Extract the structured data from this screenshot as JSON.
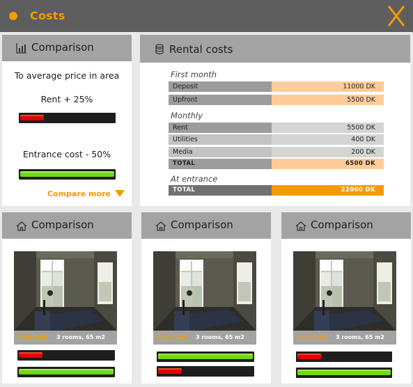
{
  "header": {
    "title": "Costs",
    "close_icon": "close-x-icon"
  },
  "colors": {
    "accent": "#f59b00",
    "header_bg": "#5e5e5e",
    "panel_head": "#a3a3a3",
    "bar_red": "#e30000",
    "bar_green": "#72d816"
  },
  "comparison": {
    "title": "Comparison",
    "subtitle": "To average price in area",
    "rent_label": "Rent + 25%",
    "rent_level": 0.25,
    "entrance_label": "Entrance cost - 50%",
    "entrance_level": 1.0,
    "compare_more": "Compare more"
  },
  "rental": {
    "title": "Rental costs",
    "first_month": {
      "heading": "First month",
      "rows": [
        {
          "label": "Deposit",
          "value": "11000 DK"
        },
        {
          "label": "Upfront",
          "value": "5500 DK"
        }
      ]
    },
    "monthly": {
      "heading": "Monthly",
      "rows": [
        {
          "label": "Rent",
          "value": "5500 DK"
        },
        {
          "label": "Utilities",
          "value": "400 DK"
        },
        {
          "label": "Media",
          "value": "200 DK"
        },
        {
          "label": "TOTAL",
          "value": "6500 DK"
        }
      ]
    },
    "at_entrance": {
      "heading": "At entrance",
      "rows": [
        {
          "label": "TOTAL",
          "value": "22000 DK"
        }
      ]
    }
  },
  "cards": [
    {
      "title": "Comparison",
      "price": "7500 DKK",
      "rooms": "3 rooms, 65 m2",
      "bar1_level": 0.25,
      "bar1_color": "red",
      "bar2_level": 1.0,
      "bar2_color": "green"
    },
    {
      "title": "Comparison",
      "price": "7500 DKK",
      "rooms": "3 rooms, 65 m2",
      "bar1_level": 1.0,
      "bar1_color": "green",
      "bar2_level": 0.25,
      "bar2_color": "red"
    },
    {
      "title": "Comparison",
      "price": "7500 DKK",
      "rooms": "3 rooms, 65 m2",
      "bar1_level": 0.25,
      "bar1_color": "red",
      "bar2_level": 1.0,
      "bar2_color": "green"
    }
  ]
}
